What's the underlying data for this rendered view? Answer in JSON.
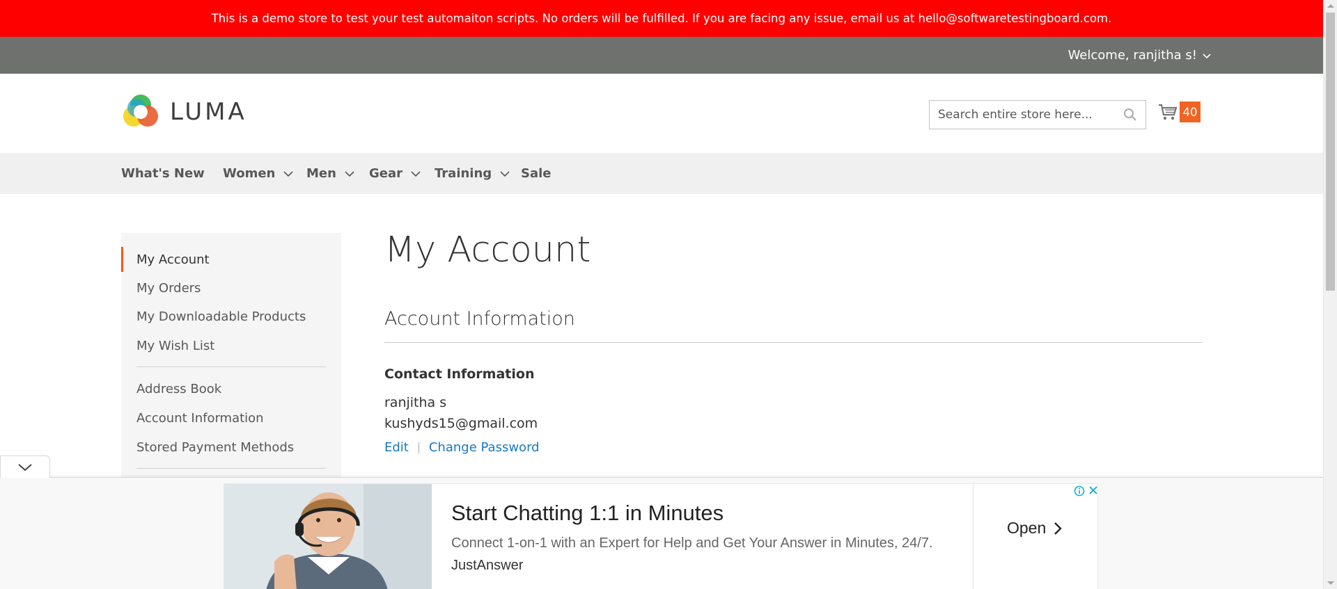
{
  "demo_notice": "This is a demo store to test your test automaiton scripts. No orders will be fulfilled. If you are facing any issue, email us at hello@softwaretestingboard.com.",
  "header_panel": {
    "welcome": "Welcome, ranjitha s!"
  },
  "logo": {
    "text": "LUMA"
  },
  "search": {
    "placeholder": "Search entire store here..."
  },
  "cart": {
    "count": "40"
  },
  "nav": {
    "items": [
      {
        "label": "What's New",
        "has_dropdown": false
      },
      {
        "label": "Women",
        "has_dropdown": true
      },
      {
        "label": "Men",
        "has_dropdown": true
      },
      {
        "label": "Gear",
        "has_dropdown": true
      },
      {
        "label": "Training",
        "has_dropdown": true
      },
      {
        "label": "Sale",
        "has_dropdown": false
      }
    ]
  },
  "sidebar": {
    "items": [
      {
        "label": "My Account",
        "active": true
      },
      {
        "label": "My Orders"
      },
      {
        "label": "My Downloadable Products"
      },
      {
        "label": "My Wish List"
      },
      {
        "label": "Address Book"
      },
      {
        "label": "Account Information"
      },
      {
        "label": "Stored Payment Methods"
      }
    ]
  },
  "main": {
    "page_title": "My Account",
    "block_title": "Account Information",
    "contact": {
      "title": "Contact Information",
      "name": "ranjitha s",
      "email": "kushyds15@gmail.com",
      "edit_label": "Edit",
      "change_password_label": "Change Password"
    }
  },
  "ad": {
    "headline": "Start Chatting 1:1 in Minutes",
    "description": "Connect 1-on-1 with an Expert for Help and Get Your Answer in Minutes, 24/7.",
    "source": "JustAnswer",
    "cta": "Open"
  },
  "colors": {
    "demo_bar": "#ff0000",
    "panel": "#6e716e",
    "accent": "#ff5501",
    "cart_badge": "#f26322",
    "link": "#1979c3"
  },
  "icons": [
    "chevron-down-icon",
    "luma-logo-icon",
    "search-icon",
    "cart-icon",
    "info-icon",
    "close-icon",
    "chevron-right-icon"
  ]
}
